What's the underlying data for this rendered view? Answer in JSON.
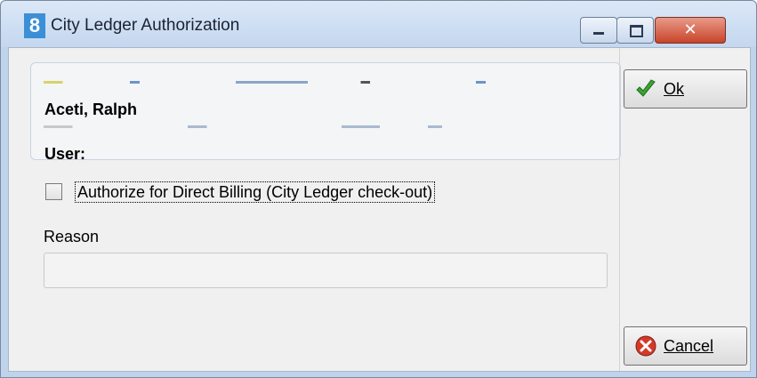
{
  "window": {
    "title": "City Ledger Authorization",
    "app_icon_glyph": "8",
    "controls": {
      "minimize_icon": "minimize-icon",
      "maximize_icon": "maximize-icon",
      "close_icon": "close-icon",
      "close_glyph": "✕"
    }
  },
  "info": {
    "guest_name": "Aceti, Ralph",
    "user_label": "User:"
  },
  "authorize": {
    "checkbox_label": "Authorize for Direct Billing (City Ledger check-out)",
    "checked": false
  },
  "reason": {
    "label": "Reason",
    "value": ""
  },
  "buttons": {
    "ok": {
      "label": "Ok",
      "icon": "checkmark-icon"
    },
    "cancel": {
      "label": "Cancel",
      "icon": "cancel-icon"
    }
  },
  "colors": {
    "titlebar": "#c4d7ef",
    "close_button": "#c8442a",
    "ok_check": "#3aa334",
    "cancel_icon": "#d23a2a"
  }
}
